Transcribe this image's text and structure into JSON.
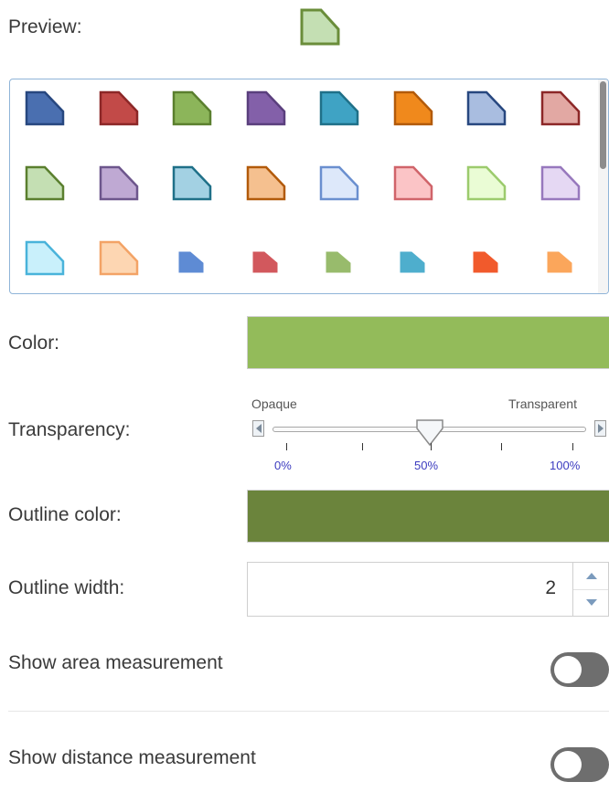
{
  "preview": {
    "label": "Preview:",
    "fill": "#c4dfb3",
    "outline": "#6a8d3a"
  },
  "gallery": {
    "symbols": [
      {
        "fill": "#4a6fb0",
        "outline": "#27477f",
        "size": "large"
      },
      {
        "fill": "#c24a48",
        "outline": "#8c2727",
        "size": "large"
      },
      {
        "fill": "#8cb55a",
        "outline": "#5a7f2e",
        "size": "large"
      },
      {
        "fill": "#8360a9",
        "outline": "#5a3f7d",
        "size": "large"
      },
      {
        "fill": "#3fa3c4",
        "outline": "#1f7088",
        "size": "large"
      },
      {
        "fill": "#f0891c",
        "outline": "#b25a0a",
        "size": "large"
      },
      {
        "fill": "#a9bde0",
        "outline": "#27477f",
        "size": "large"
      },
      {
        "fill": "#e2a8a3",
        "outline": "#8c2727",
        "size": "large"
      },
      {
        "fill": "#c4dfb3",
        "outline": "#5a7f2e",
        "size": "large"
      },
      {
        "fill": "#bfa9d3",
        "outline": "#6d568c",
        "size": "large"
      },
      {
        "fill": "#a3d1e3",
        "outline": "#1f7088",
        "size": "large"
      },
      {
        "fill": "#f5c08f",
        "outline": "#b25a0a",
        "size": "large"
      },
      {
        "fill": "#dde8fa",
        "outline": "#6a8fcf",
        "size": "large"
      },
      {
        "fill": "#fbc4c6",
        "outline": "#d0646a",
        "size": "large"
      },
      {
        "fill": "#eafcd5",
        "outline": "#9ccb6d",
        "size": "large"
      },
      {
        "fill": "#e5d8f3",
        "outline": "#9778bd",
        "size": "large"
      },
      {
        "fill": "#c9f0fb",
        "outline": "#49b3da",
        "size": "large"
      },
      {
        "fill": "#fdd6b2",
        "outline": "#f3a366",
        "size": "large"
      },
      {
        "fill": "#5e8bd4",
        "outline": "#5e8bd4",
        "size": "small"
      },
      {
        "fill": "#d2585d",
        "outline": "#d2585d",
        "size": "small"
      },
      {
        "fill": "#98bb6c",
        "outline": "#98bb6c",
        "size": "small"
      },
      {
        "fill": "#4eaecd",
        "outline": "#4eaecd",
        "size": "small"
      },
      {
        "fill": "#f15a2c",
        "outline": "#f15a2c",
        "size": "small"
      },
      {
        "fill": "#fba65b",
        "outline": "#fba65b",
        "size": "small"
      }
    ]
  },
  "color": {
    "label": "Color:",
    "value": "#93bb5a"
  },
  "transparency": {
    "label": "Transparency:",
    "opaque_label": "Opaque",
    "transparent_label": "Transparent",
    "min_label": "0%",
    "mid_label": "50%",
    "max_label": "100%",
    "value_percent": 50
  },
  "outline_color": {
    "label": "Outline color:",
    "value": "#6b843c"
  },
  "outline_width": {
    "label": "Outline width:",
    "value": "2"
  },
  "area_measurement": {
    "label": "Show area measurement",
    "enabled": false
  },
  "distance_measurement": {
    "label": "Show distance measurement",
    "enabled": false
  }
}
